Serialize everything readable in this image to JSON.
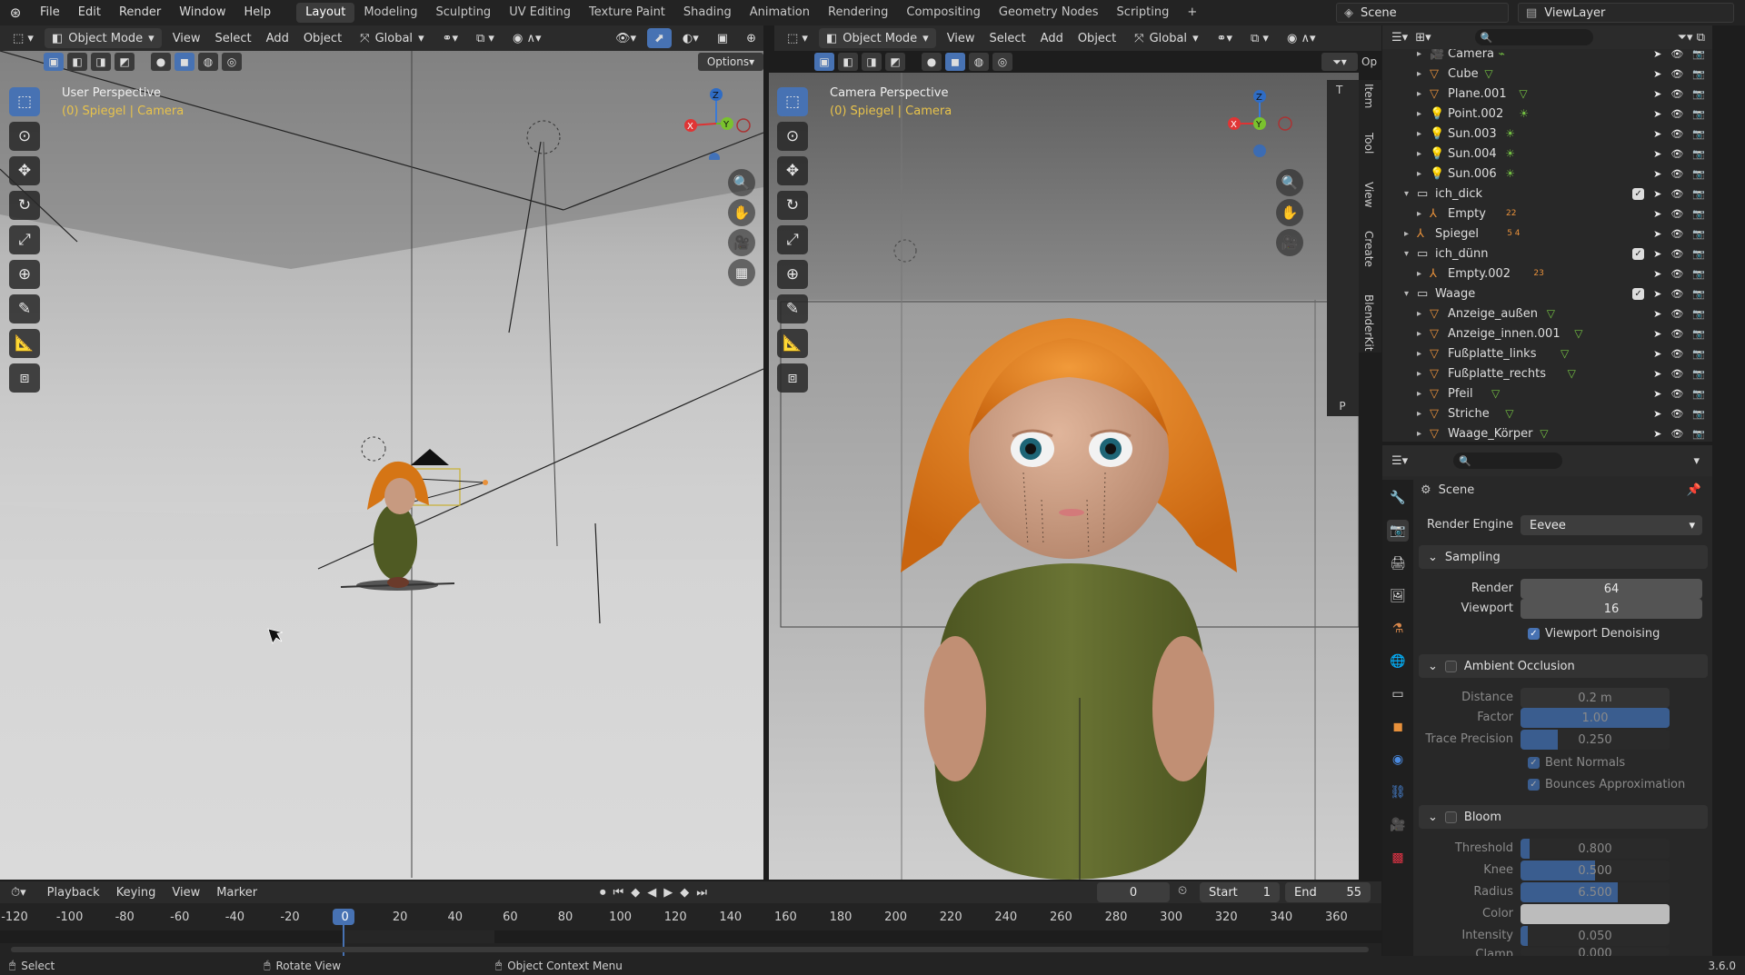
{
  "app": {
    "menus": [
      "File",
      "Edit",
      "Render",
      "Window",
      "Help"
    ],
    "workspaces": [
      "Layout",
      "Modeling",
      "Sculpting",
      "UV Editing",
      "Texture Paint",
      "Shading",
      "Animation",
      "Rendering",
      "Compositing",
      "Geometry Nodes",
      "Scripting",
      "+"
    ],
    "active_workspace": "Layout",
    "scene": "Scene",
    "view_layer": "ViewLayer"
  },
  "left_view": {
    "mode": "Object Mode",
    "menus": [
      "View",
      "Select",
      "Add",
      "Object"
    ],
    "orientation": "Global",
    "options_label": "Options",
    "title": "User Perspective",
    "subtitle": "(0) Spiegel | Camera"
  },
  "right_view": {
    "mode": "Object Mode",
    "menus": [
      "View",
      "Select",
      "Add",
      "Object"
    ],
    "orientation": "Global",
    "title": "Camera Perspective",
    "subtitle": "(0) Spiegel | Camera",
    "side_tabs": [
      "Item",
      "Tool",
      "View",
      "Create",
      "BlenderKit"
    ],
    "tab_t": "T",
    "tab_p": "P",
    "tab_op": "Op"
  },
  "gizmo": {
    "x": "X",
    "y": "Y",
    "z": "Z"
  },
  "outliner": {
    "rows": [
      {
        "name": "Camera",
        "indent": 3,
        "icon": "camera",
        "coll": false
      },
      {
        "name": "Cube",
        "indent": 3,
        "icon": "mesh",
        "coll": false
      },
      {
        "name": "Plane.001",
        "indent": 3,
        "icon": "mesh",
        "coll": false
      },
      {
        "name": "Point.002",
        "indent": 3,
        "icon": "light",
        "coll": false
      },
      {
        "name": "Sun.003",
        "indent": 3,
        "icon": "light",
        "coll": false
      },
      {
        "name": "Sun.004",
        "indent": 3,
        "icon": "light",
        "coll": false
      },
      {
        "name": "Sun.006",
        "indent": 3,
        "icon": "light",
        "coll": false
      },
      {
        "name": "ich_dick",
        "indent": 2,
        "icon": "collection",
        "coll": true,
        "open": true
      },
      {
        "name": "Empty",
        "indent": 3,
        "icon": "empty",
        "coll": false,
        "badge": "22"
      },
      {
        "name": "Spiegel",
        "indent": 2,
        "icon": "empty",
        "coll": false,
        "open": false,
        "badge": "5 4"
      },
      {
        "name": "ich_dünn",
        "indent": 2,
        "icon": "collection",
        "coll": true,
        "open": true
      },
      {
        "name": "Empty.002",
        "indent": 3,
        "icon": "empty",
        "coll": false,
        "badge": "23"
      },
      {
        "name": "Waage",
        "indent": 2,
        "icon": "collection",
        "coll": true,
        "open": true
      },
      {
        "name": "Anzeige_außen",
        "indent": 3,
        "icon": "mesh",
        "coll": false
      },
      {
        "name": "Anzeige_innen.001",
        "indent": 3,
        "icon": "mesh",
        "coll": false
      },
      {
        "name": "Fußplatte_links",
        "indent": 3,
        "icon": "mesh",
        "coll": false
      },
      {
        "name": "Fußplatte_rechts",
        "indent": 3,
        "icon": "mesh",
        "coll": false
      },
      {
        "name": "Pfeil",
        "indent": 3,
        "icon": "mesh",
        "coll": false
      },
      {
        "name": "Striche",
        "indent": 3,
        "icon": "mesh",
        "coll": false
      },
      {
        "name": "Waage_Körper",
        "indent": 3,
        "icon": "mesh",
        "coll": false
      }
    ]
  },
  "properties": {
    "scene_label": "Scene",
    "render_engine_label": "Render Engine",
    "render_engine": "Eevee",
    "sampling": {
      "title": "Sampling",
      "render_label": "Render",
      "render": "64",
      "viewport_label": "Viewport",
      "viewport": "16",
      "denoise": "Viewport Denoising"
    },
    "ao": {
      "title": "Ambient Occlusion",
      "distance_label": "Distance",
      "distance": "0.2 m",
      "factor_label": "Factor",
      "factor": "1.00",
      "factor_fill": 1.0,
      "trace_label": "Trace Precision",
      "trace": "0.250",
      "trace_fill": 0.25,
      "bent": "Bent Normals",
      "bounces": "Bounces Approximation"
    },
    "bloom": {
      "title": "Bloom",
      "threshold_label": "Threshold",
      "threshold": "0.800",
      "threshold_fill": 0.06,
      "knee_label": "Knee",
      "knee": "0.500",
      "knee_fill": 0.5,
      "radius_label": "Radius",
      "radius": "6.500",
      "radius_fill": 0.65,
      "color_label": "Color",
      "intensity_label": "Intensity",
      "intensity": "0.050",
      "intensity_fill": 0.05,
      "clamp_label": "Clamp",
      "clamp": "0.000"
    }
  },
  "timeline": {
    "menus": [
      "Playback",
      "Keying",
      "View",
      "Marker"
    ],
    "current": "0",
    "start_label": "Start",
    "start": "1",
    "end_label": "End",
    "end": "55",
    "ticks": [
      "-120",
      "-100",
      "-80",
      "-60",
      "-40",
      "-20",
      "0",
      "20",
      "40",
      "60",
      "80",
      "100",
      "120",
      "140",
      "160",
      "180",
      "200",
      "220",
      "240",
      "260",
      "280",
      "300",
      "320",
      "340",
      "360"
    ]
  },
  "status": {
    "select": "Select",
    "rotate": "Rotate View",
    "context": "Object Context Menu",
    "version": "3.6.0"
  },
  "colors": {
    "accent": "#4772b3",
    "highlight": "#e8c34b",
    "orange_icon": "#e8913b",
    "green_icon": "#74c043"
  }
}
